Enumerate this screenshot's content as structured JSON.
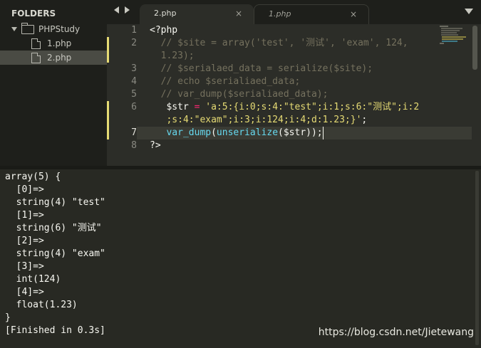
{
  "sidebar": {
    "title": "FOLDERS",
    "folder": "PHPStudy",
    "files": [
      "1.php",
      "2.php"
    ],
    "selected_file": "2.php"
  },
  "tabs": [
    {
      "label": "2.php",
      "close": "×",
      "active": true
    },
    {
      "label": "1.php",
      "close": "×",
      "active": false
    }
  ],
  "editor": {
    "line_numbers": [
      "1",
      "2",
      "",
      "3",
      "4",
      "5",
      "6",
      "",
      "7",
      "8"
    ],
    "code": {
      "l1": "<?php",
      "l2a": "  // $site = array('test', '测试', 'exam', 124,",
      "l2b": "  1.23);",
      "l3": "  // $serialaed_data = serialize($site);",
      "l4": "  // echo $serialiaed_data;",
      "l5": "  // var_dump($serialiaed_data);",
      "l6_var": "   $str",
      "l6_op": " = ",
      "l6_str": "'a:5:{i:0;s:4:\"test\";i:1;s:6:\"测试\";i:2",
      "l6b_str": "   ;s:4:\"exam\";i:3;i:124;i:4;d:1.23;}'",
      "l6b_end": ";",
      "l7_fn1": "   var_dump",
      "l7_p1": "(",
      "l7_fn2": "unserialize",
      "l7_rest": "($str));",
      "l8": "?>"
    }
  },
  "output": {
    "lines": [
      "array(5) {",
      "  [0]=>",
      "  string(4) \"test\"",
      "  [1]=>",
      "  string(6) \"测试\"",
      "  [2]=>",
      "  string(4) \"exam\"",
      "  [3]=>",
      "  int(124)",
      "  [4]=>",
      "  float(1.23)",
      "}",
      "[Finished in 0.3s]"
    ],
    "watermark": "https://blog.csdn.net/Jietewang"
  }
}
